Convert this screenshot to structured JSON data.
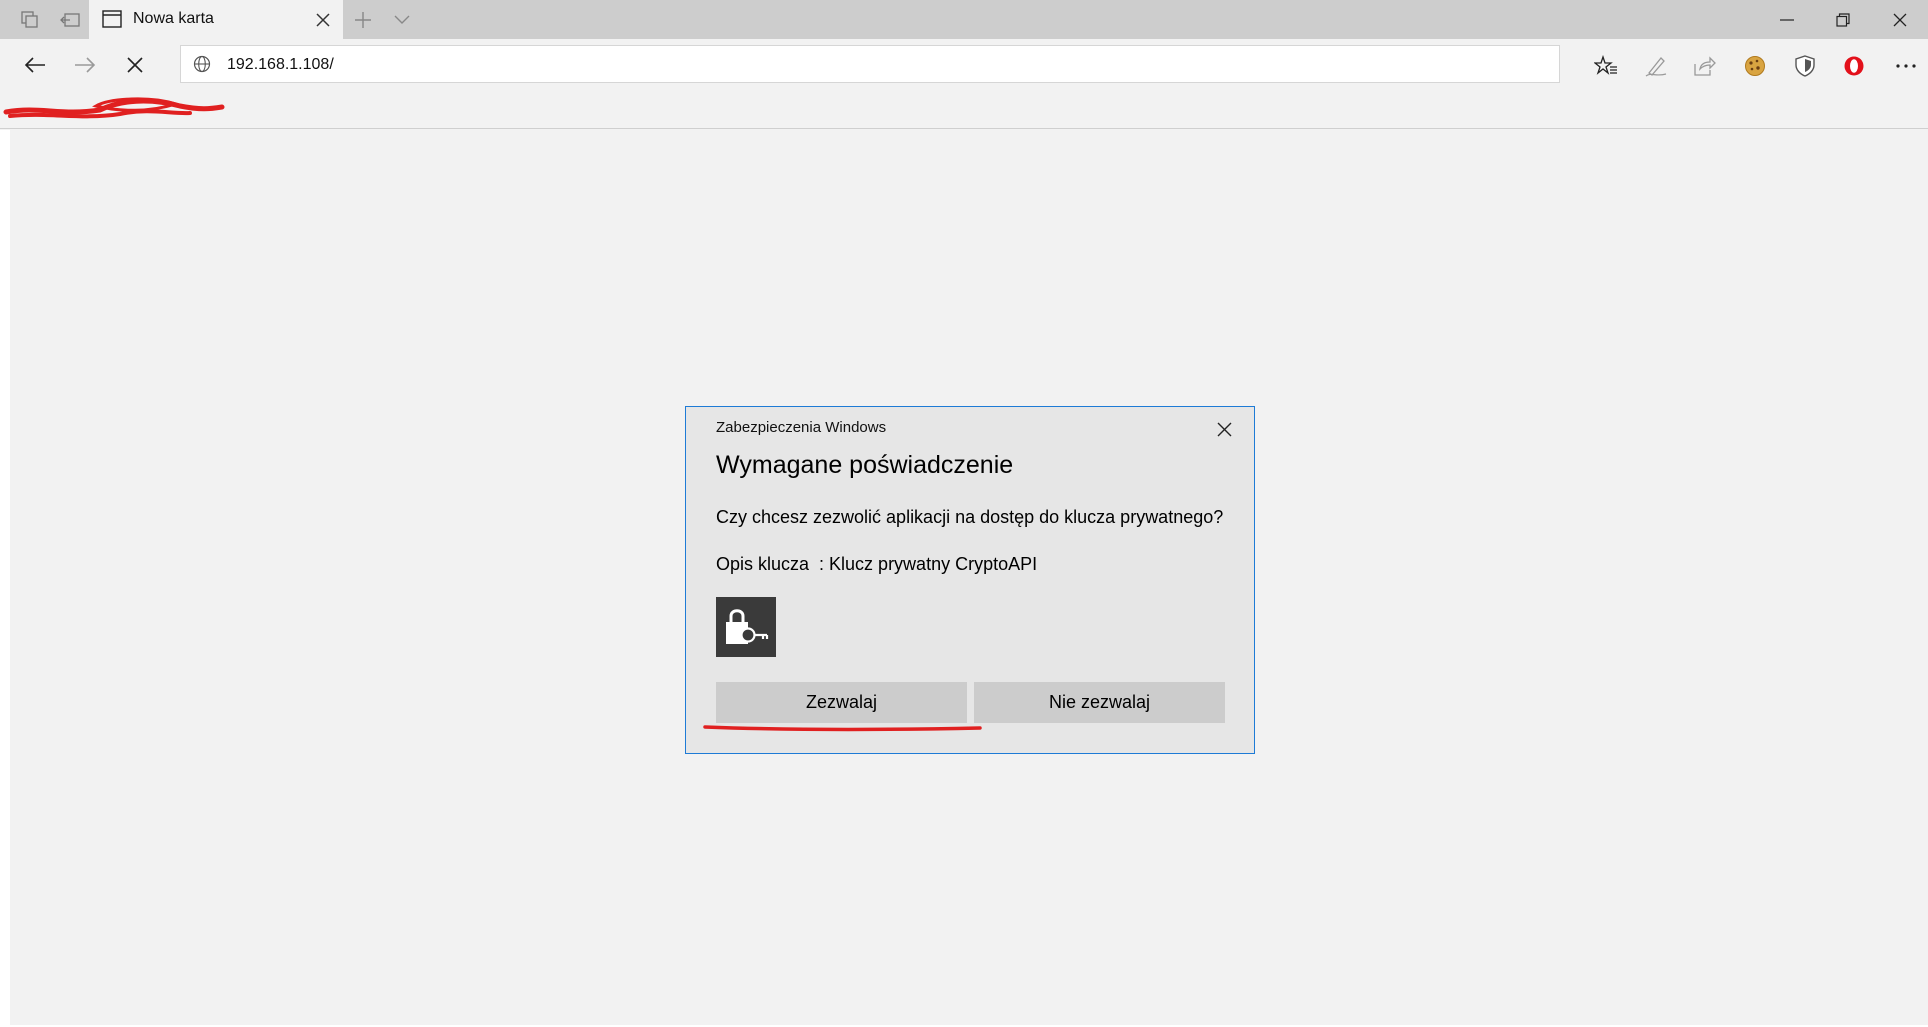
{
  "browser": {
    "tab": {
      "title": "Nowa karta"
    },
    "address_bar": {
      "url": "192.168.1.108/"
    },
    "toolbar_icons": [
      "tabs-aside-icon",
      "set-aside-icon",
      "new-tab-icon",
      "tab-list-icon",
      "favorites-icon",
      "pen-icon",
      "share-icon",
      "cookie-icon",
      "shield-icon",
      "opera-icon",
      "more-icon"
    ],
    "window_controls": [
      "minimize-icon",
      "restore-icon",
      "close-icon"
    ]
  },
  "dialog": {
    "caption": "Zabezpieczenia Windows",
    "title": "Wymagane poświadczenie",
    "question": "Czy chcesz zezwolić aplikacji na dostęp do klucza prywatnego?",
    "key_description": "Opis klucza  : Klucz prywatny CryptoAPI",
    "allow_label": "Zezwalaj",
    "deny_label": "Nie zezwalaj"
  },
  "colors": {
    "dialog_border": "#1e7bd6",
    "annotation_red": "#e02020",
    "tabbar_bg": "#cdcdcd",
    "page_bg": "#f2f2f2"
  }
}
